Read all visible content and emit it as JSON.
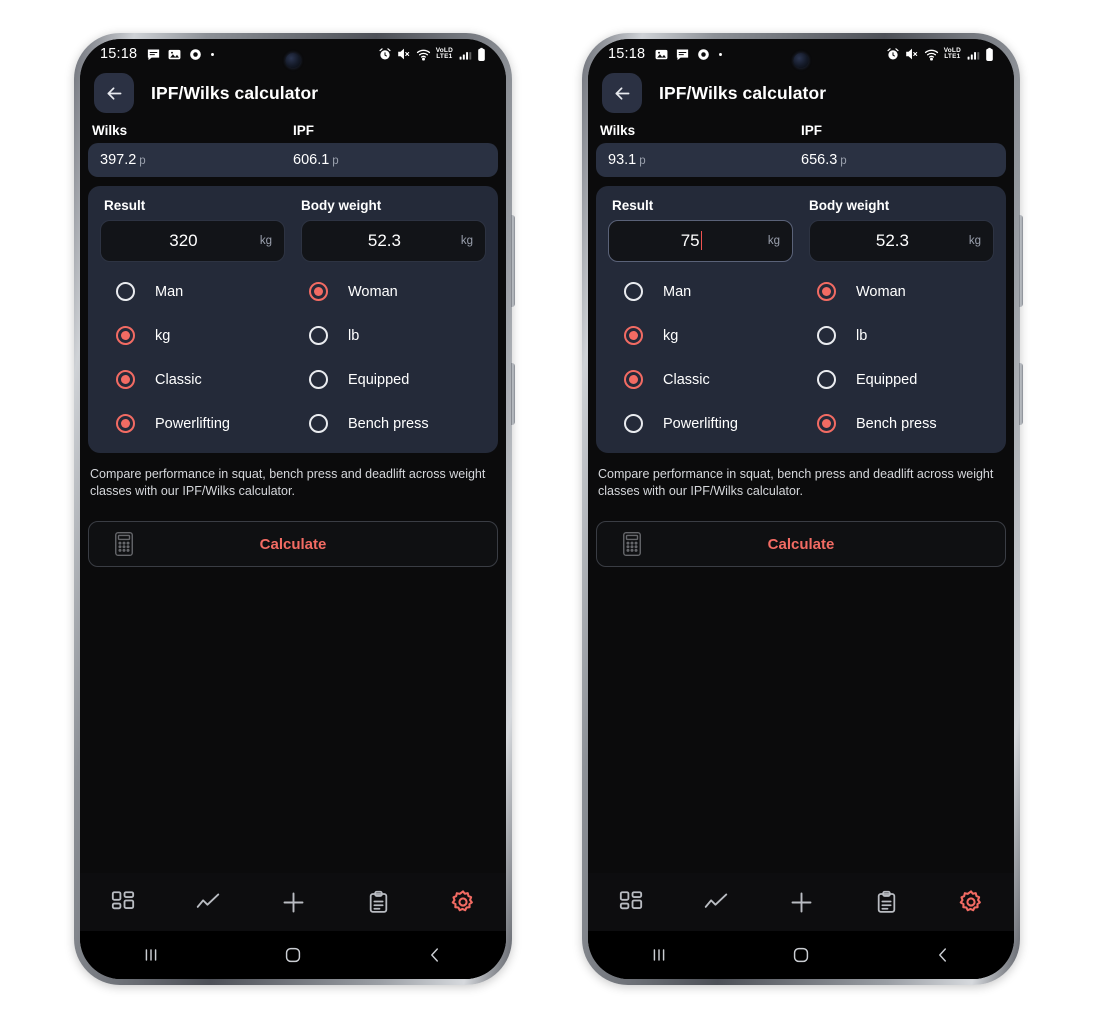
{
  "phones": [
    {
      "id": "left",
      "status_bar": {
        "time": "15:18",
        "left_icons": [
          "chat-bubble-icon",
          "image-icon",
          "record-circle-icon",
          "dot-icon"
        ],
        "right_icons": [
          "alarm-icon",
          "mute-icon",
          "wifi-icon",
          "volte-lte1-icon",
          "signal-bars-icon",
          "battery-icon"
        ],
        "volte_top": "VoLD",
        "volte_bottom": "LTE1"
      },
      "appbar": {
        "back": "back-arrow-icon",
        "title": "IPF/Wilks calculator"
      },
      "scores": {
        "wilks_label": "Wilks",
        "ipf_label": "IPF",
        "wilks_value": "397.2",
        "wilks_unit": "p",
        "ipf_value": "606.1",
        "ipf_unit": "p"
      },
      "form": {
        "result_label": "Result",
        "bodyweight_label": "Body weight",
        "result_value": "320",
        "result_unit": "kg",
        "result_focused": false,
        "bodyweight_value": "52.3",
        "bodyweight_unit": "kg"
      },
      "radio_rows": [
        [
          {
            "label": "Man",
            "selected": false
          },
          {
            "label": "Woman",
            "selected": true
          }
        ],
        [
          {
            "label": "kg",
            "selected": true
          },
          {
            "label": "lb",
            "selected": false
          }
        ],
        [
          {
            "label": "Classic",
            "selected": true
          },
          {
            "label": "Equipped",
            "selected": false
          }
        ],
        [
          {
            "label": "Powerlifting",
            "selected": true
          },
          {
            "label": "Bench press",
            "selected": false
          }
        ]
      ],
      "description": "Compare performance in squat, bench press and deadlift across weight classes with our IPF/Wilks calculator.",
      "calculate_label": "Calculate",
      "bottom_nav": [
        "dashboard-grid-icon",
        "chart-line-icon",
        "plus-icon",
        "clipboard-icon",
        "gear-icon"
      ],
      "bottom_nav_active_index": 4,
      "system_nav": [
        "recents-icon",
        "home-icon",
        "back-icon"
      ]
    },
    {
      "id": "right",
      "status_bar": {
        "time": "15:18",
        "left_icons": [
          "image-icon",
          "chat-bubble-icon",
          "record-circle-icon",
          "dot-icon"
        ],
        "right_icons": [
          "alarm-icon",
          "mute-icon",
          "wifi-icon",
          "volte-lte1-icon",
          "signal-bars-icon",
          "battery-icon"
        ],
        "volte_top": "VoLD",
        "volte_bottom": "LTE1"
      },
      "appbar": {
        "back": "back-arrow-icon",
        "title": "IPF/Wilks calculator"
      },
      "scores": {
        "wilks_label": "Wilks",
        "ipf_label": "IPF",
        "wilks_value": "93.1",
        "wilks_unit": "p",
        "ipf_value": "656.3",
        "ipf_unit": "p"
      },
      "form": {
        "result_label": "Result",
        "bodyweight_label": "Body weight",
        "result_value": "75",
        "result_unit": "kg",
        "result_focused": true,
        "bodyweight_value": "52.3",
        "bodyweight_unit": "kg"
      },
      "radio_rows": [
        [
          {
            "label": "Man",
            "selected": false
          },
          {
            "label": "Woman",
            "selected": true
          }
        ],
        [
          {
            "label": "kg",
            "selected": true
          },
          {
            "label": "lb",
            "selected": false
          }
        ],
        [
          {
            "label": "Classic",
            "selected": true
          },
          {
            "label": "Equipped",
            "selected": false
          }
        ],
        [
          {
            "label": "Powerlifting",
            "selected": false
          },
          {
            "label": "Bench press",
            "selected": true
          }
        ]
      ],
      "description": "Compare performance in squat, bench press and deadlift across weight classes with our IPF/Wilks calculator.",
      "calculate_label": "Calculate",
      "bottom_nav": [
        "dashboard-grid-icon",
        "chart-line-icon",
        "plus-icon",
        "clipboard-icon",
        "gear-icon"
      ],
      "bottom_nav_active_index": 4,
      "system_nav": [
        "recents-icon",
        "home-icon",
        "back-icon"
      ]
    }
  ],
  "colors": {
    "accent": "#f26b63",
    "card": "#242a39",
    "score_bar": "#2a3142",
    "screen_bg": "#0b0b0c",
    "input_bg": "#121418"
  }
}
